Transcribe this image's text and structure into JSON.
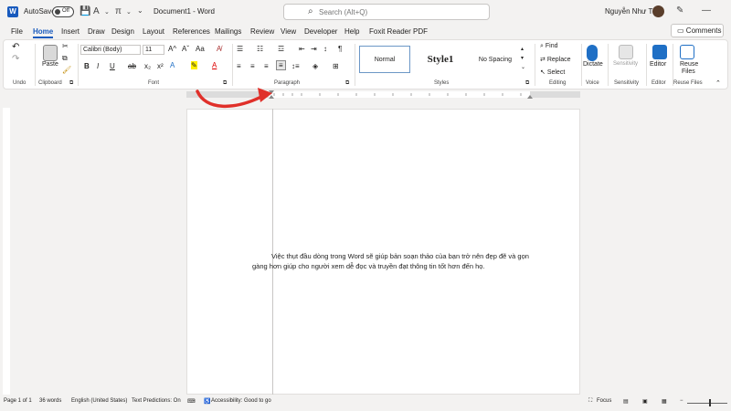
{
  "titlebar": {
    "autosave_label": "AutoSave",
    "autosave_state": "Off",
    "document_title": "Document1  -  Word",
    "search_placeholder": "Search (Alt+Q)",
    "user_name": "Nguyễn Như Tài"
  },
  "menu": {
    "tabs": [
      "File",
      "Home",
      "Insert",
      "Draw",
      "Design",
      "Layout",
      "References",
      "Mailings",
      "Review",
      "View",
      "Developer",
      "Help",
      "Foxit Reader PDF"
    ],
    "active_tab": "Home",
    "comments_label": "Comments"
  },
  "ribbon": {
    "undo_label": "Undo",
    "clipboard": {
      "label": "Clipboard",
      "paste": "Paste"
    },
    "font": {
      "label": "Font",
      "font_name": "Calibri (Body)",
      "font_size": "11",
      "aa_label": "Aa"
    },
    "paragraph": {
      "label": "Paragraph"
    },
    "styles": {
      "label": "Styles",
      "normal": "Normal",
      "style1": "Style1",
      "no_spacing": "No Spacing"
    },
    "editing": {
      "label": "Editing",
      "find": "Find",
      "replace": "Replace",
      "select": "Select"
    },
    "voice": {
      "label": "Voice",
      "dictate": "Dictate"
    },
    "sensitivity": {
      "label": "Sensitivity",
      "button": "Sensitivity"
    },
    "editor": {
      "label": "Editor",
      "button": "Editor"
    },
    "reuse": {
      "label": "Reuse Files",
      "button_line1": "Reuse",
      "button_line2": "Files"
    }
  },
  "document": {
    "line1": "Việc thụt đầu dòng trong Word sẽ giúp bản soạn thảo của bạn trở nên đẹp đẽ và gọn",
    "line2": "gàng hơn giúp cho người xem dễ đọc và truyền đạt thông tin tốt hơn đến họ."
  },
  "status": {
    "page": "Page 1 of 1",
    "words": "36 words",
    "language": "English (United States)",
    "predictions": "Text Predictions: On",
    "accessibility": "Accessibility: Good to go",
    "focus": "Focus"
  },
  "colors": {
    "accent": "#185abd",
    "arrow": "#e0302a"
  }
}
